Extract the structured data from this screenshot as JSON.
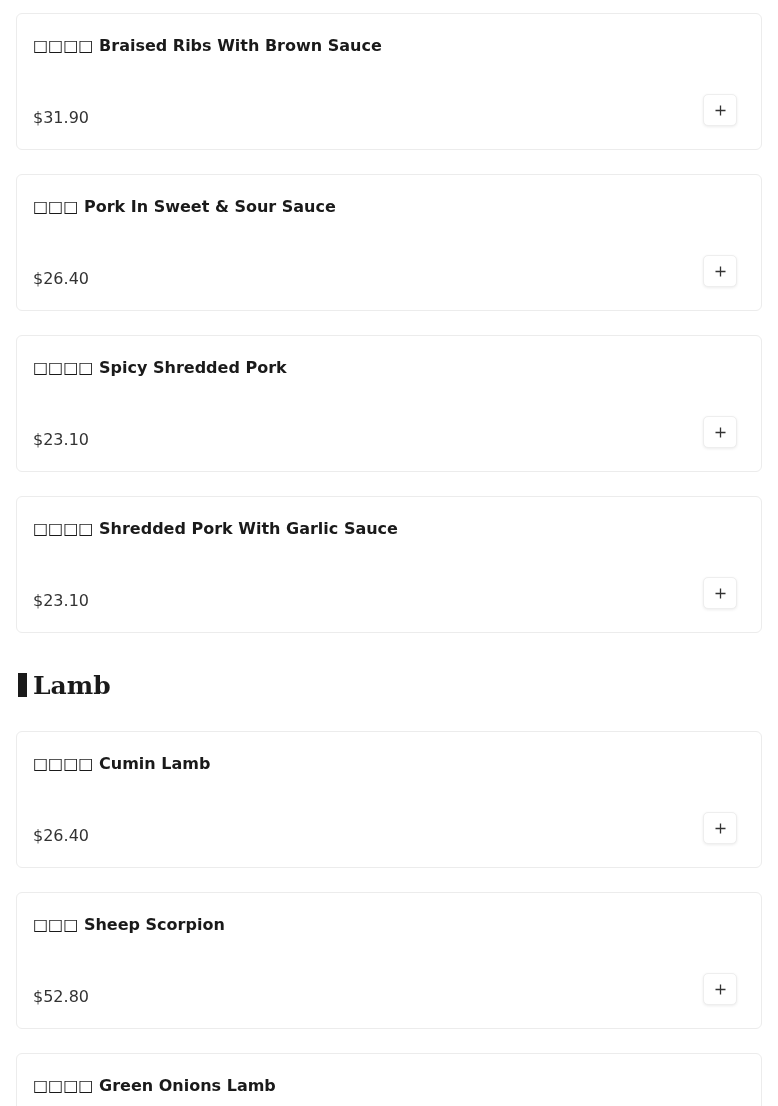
{
  "menu": [
    {
      "kind": "dish",
      "name": "□□□□ Braised Ribs With Brown Sauce",
      "price": "$31.90"
    },
    {
      "kind": "dish",
      "name": "□□□ Pork In Sweet & Sour Sauce",
      "price": "$26.40"
    },
    {
      "kind": "dish",
      "name": "□□□□ Spicy Shredded Pork",
      "price": "$23.10"
    },
    {
      "kind": "dish",
      "name": "□□□□ Shredded Pork With Garlic Sauce",
      "price": "$23.10"
    },
    {
      "kind": "section",
      "title": "Lamb"
    },
    {
      "kind": "dish",
      "name": "□□□□ Cumin Lamb",
      "price": "$26.40"
    },
    {
      "kind": "dish",
      "name": "□□□ Sheep Scorpion",
      "price": "$52.80"
    },
    {
      "kind": "dish",
      "name": "□□□□ Green Onions Lamb"
    }
  ]
}
